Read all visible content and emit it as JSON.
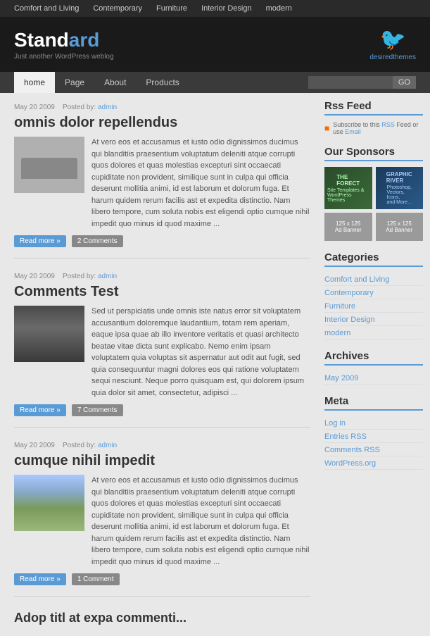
{
  "topnav": {
    "items": [
      {
        "label": "Comfort and Living",
        "id": "nav-comfort"
      },
      {
        "label": "Contemporary",
        "id": "nav-contemporary"
      },
      {
        "label": "Furniture",
        "id": "nav-furniture"
      },
      {
        "label": "Interior Design",
        "id": "nav-interior"
      },
      {
        "label": "modern",
        "id": "nav-modern"
      }
    ]
  },
  "header": {
    "logo_std": "Stand",
    "logo_ard": "ard",
    "logo_sub": "Just another WordPress weblog",
    "twitter_label": "desiredthemes"
  },
  "mainnav": {
    "items": [
      {
        "label": "home",
        "active": true
      },
      {
        "label": "Page"
      },
      {
        "label": "About"
      },
      {
        "label": "Products"
      }
    ],
    "search_placeholder": "",
    "search_button": "GO"
  },
  "posts": [
    {
      "date": "May 20 2009",
      "author": "admin",
      "title": "omnis dolor repellendus",
      "excerpt": "At vero eos et accusamus et iusto odio dignissimos ducimus qui blanditiis praesentium voluptatum deleniti atque corrupti quos dolores et quas molestias excepturi sint occaecati cupiditate non provident, similique sunt in culpa qui officia deserunt mollitia animi, id est laborum et dolorum fuga. Et harum quidem rerum facilis ast et expedita distinctio. Nam libero tempore, cum soluta nobis est eligendi optio cumque nihil impedit quo minus id quod maxime ...",
      "read_more": "Read more »",
      "comments": "2 Comments"
    },
    {
      "date": "May 20 2009",
      "author": "admin",
      "title": "Comments Test",
      "excerpt": "Sed ut perspiciatis unde omnis iste natus error sit voluptatem accusantium doloremque laudantium, totam rem aperiam, eaque ipsa quae ab illo inventore veritatis et quasi architecto beatae vitae dicta sunt explicabo. Nemo enim ipsam voluptatem quia voluptas sit aspernatur aut odit aut fugit, sed quia consequuntur magni dolores eos qui ratione voluptatem sequi nesciunt. Neque porro quisquam est, qui dolorem ipsum quia dolor sit amet, consectetur, adipisci ...",
      "read_more": "Read more »",
      "comments": "7 Comments"
    },
    {
      "date": "May 20 2009",
      "author": "admin",
      "title": "cumque nihil impedit",
      "excerpt": "At vero eos et accusamus et iusto odio dignissimos ducimus qui blanditiis praesentium voluptatum deleniti atque corrupti quos dolores et quas molestias excepturi sint occaecati cupiditate non provident, similique sunt in culpa qui officia deserunt mollitia animi, id est laborum et dolorum fuga. Et harum quidem rerum facilis ast et expedita distinctio. Nam libero tempore, cum soluta nobis est eligendi optio cumque nihil impedit quo minus id quod maxime ...",
      "read_more": "Read more »",
      "comments": "1 Comment"
    }
  ],
  "sidebar": {
    "rss": {
      "title": "Rss Feed",
      "text": "Subscribe to this RSS Feed or use Email"
    },
    "sponsors": {
      "title": "Our Sponsors",
      "forest": {
        "line1": "THE",
        "line2": "FORECT",
        "line3": "Site Templates &",
        "line4": "WordPress Themes"
      },
      "river": {
        "line1": "GRAPHIC",
        "line2": "RIVER",
        "line3": "Photoshop,",
        "line4": "Vectors,",
        "line5": "Icons,",
        "line6": "and More..."
      },
      "ad1": "125 x 125\nAd Banner",
      "ad2": "125 x 125\nAd Banner"
    },
    "categories": {
      "title": "Categories",
      "items": [
        {
          "label": "Comfort and Living"
        },
        {
          "label": "Contemporary"
        },
        {
          "label": "Furniture"
        },
        {
          "label": "Interior Design"
        },
        {
          "label": "modern"
        }
      ]
    },
    "archives": {
      "title": "Archives",
      "items": [
        {
          "label": "May 2009"
        }
      ]
    },
    "meta": {
      "title": "Meta",
      "items": [
        {
          "label": "Log in"
        },
        {
          "label": "Entries RSS"
        },
        {
          "label": "Comments RSS"
        },
        {
          "label": "WordPress.org"
        }
      ]
    }
  },
  "footer": {
    "text": ""
  }
}
